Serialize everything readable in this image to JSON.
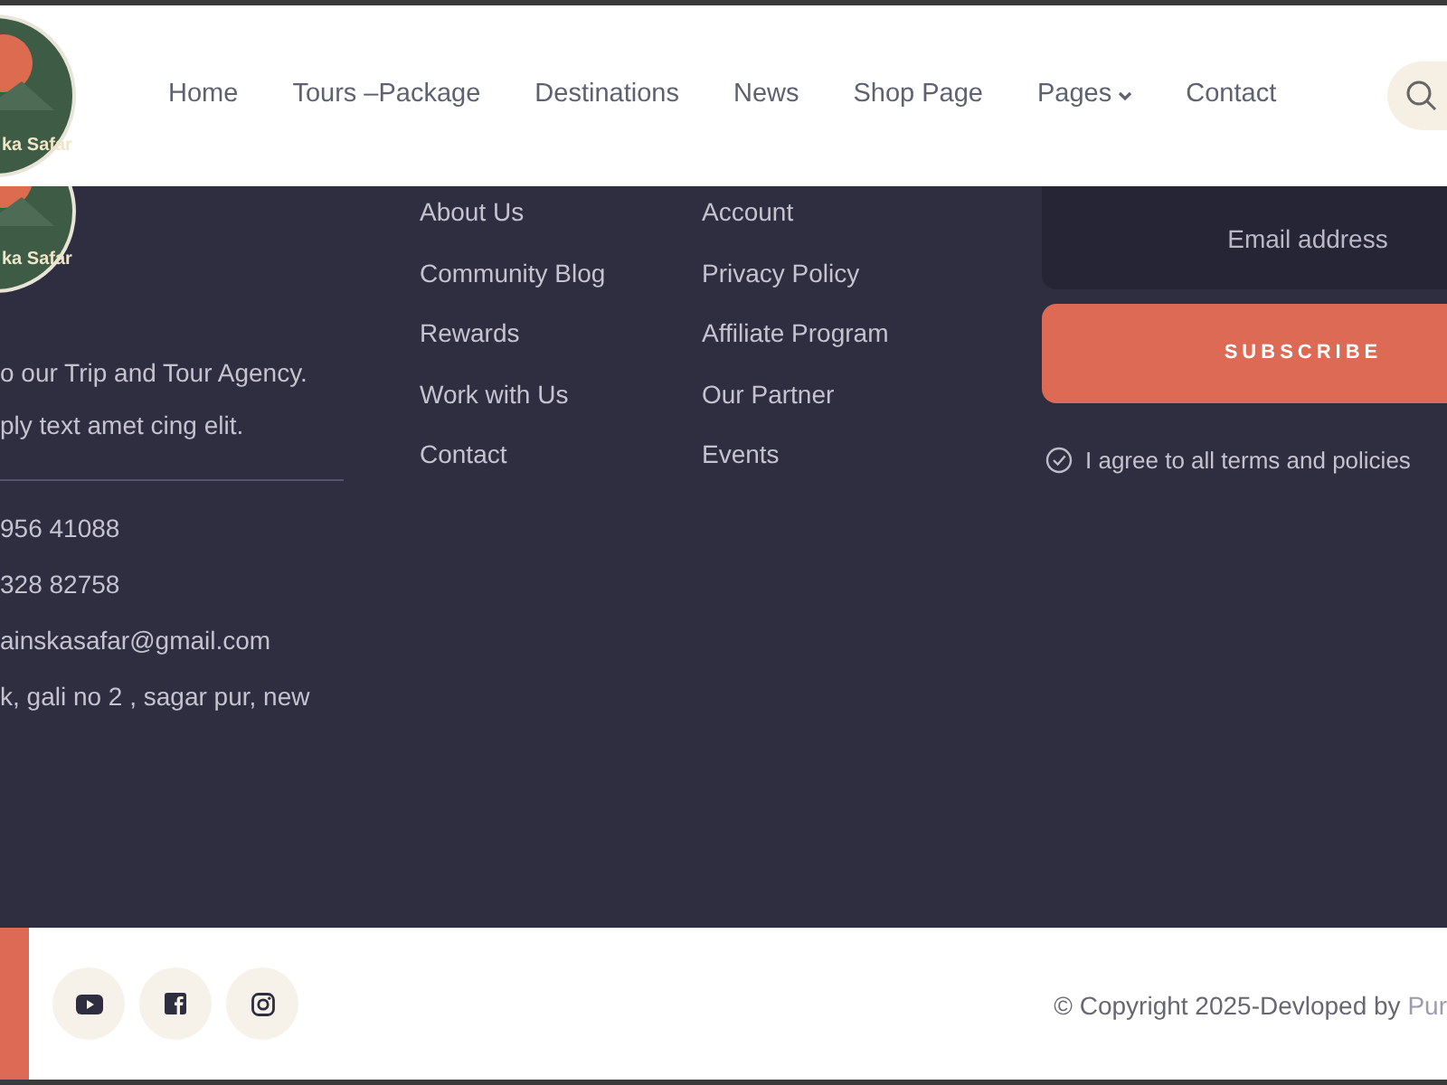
{
  "header": {
    "logo_text": "ka Safar",
    "nav": [
      {
        "label": "Home",
        "dropdown": false
      },
      {
        "label": "Tours –Package",
        "dropdown": false
      },
      {
        "label": "Destinations",
        "dropdown": false
      },
      {
        "label": "News",
        "dropdown": false
      },
      {
        "label": "Shop Page",
        "dropdown": false
      },
      {
        "label": "Pages",
        "dropdown": true
      },
      {
        "label": "Contact",
        "dropdown": false
      }
    ]
  },
  "footer": {
    "logo_text": "ka Safar",
    "about": [
      "o our Trip and Tour Agency.",
      "ply text amet cing elit."
    ],
    "contacts": [
      "956 41088",
      "328 82758",
      "ainskasafar@gmail.com",
      "k, gali no 2 , sagar pur, new"
    ],
    "links_1": [
      "About Us",
      "Community Blog",
      "Rewards",
      "Work with Us",
      "Contact"
    ],
    "links_2": [
      "Account",
      "Privacy Policy",
      "Affiliate Program",
      "Our Partner",
      "Events"
    ],
    "newsletter": {
      "placeholder": "Email address",
      "button": "SUBSCRIBE",
      "agree": {
        "label": "I agree to all terms and policies",
        "checked": true
      }
    }
  },
  "bottom_bar": {
    "social": [
      {
        "kind": "youtube"
      },
      {
        "kind": "facebook"
      },
      {
        "kind": "instagram"
      }
    ],
    "copyright": "© Copyright 2025-Devloped by ",
    "credit_link": "Pur"
  }
}
